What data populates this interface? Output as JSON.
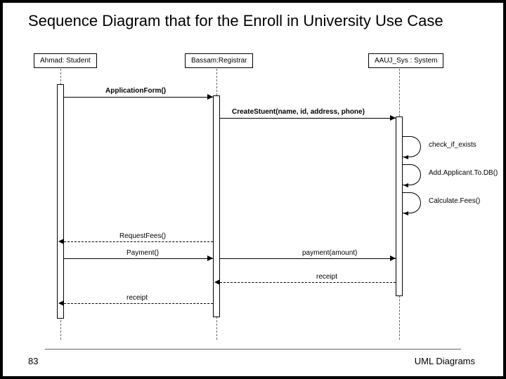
{
  "title": "Sequence Diagram that for the Enroll in University Use Case",
  "page_number": "83",
  "footer": "UML Diagrams",
  "lifelines": {
    "student": "Ahmad: Student",
    "registrar": "Bassam:Registrar",
    "system": "AAUJ_Sys : System"
  },
  "messages": {
    "m1": "ApplicationForm()",
    "m2": "CreateStuent(name, id, address, phone)",
    "m3": "check_if_exists",
    "m4": "Add.Applicant.To.DB()",
    "m5": "Calculate.Fees()",
    "m6": "RequestFees()",
    "m7": "Payment()",
    "m8": "payment(amount)",
    "m9": "receipt",
    "m10": "receipt"
  }
}
